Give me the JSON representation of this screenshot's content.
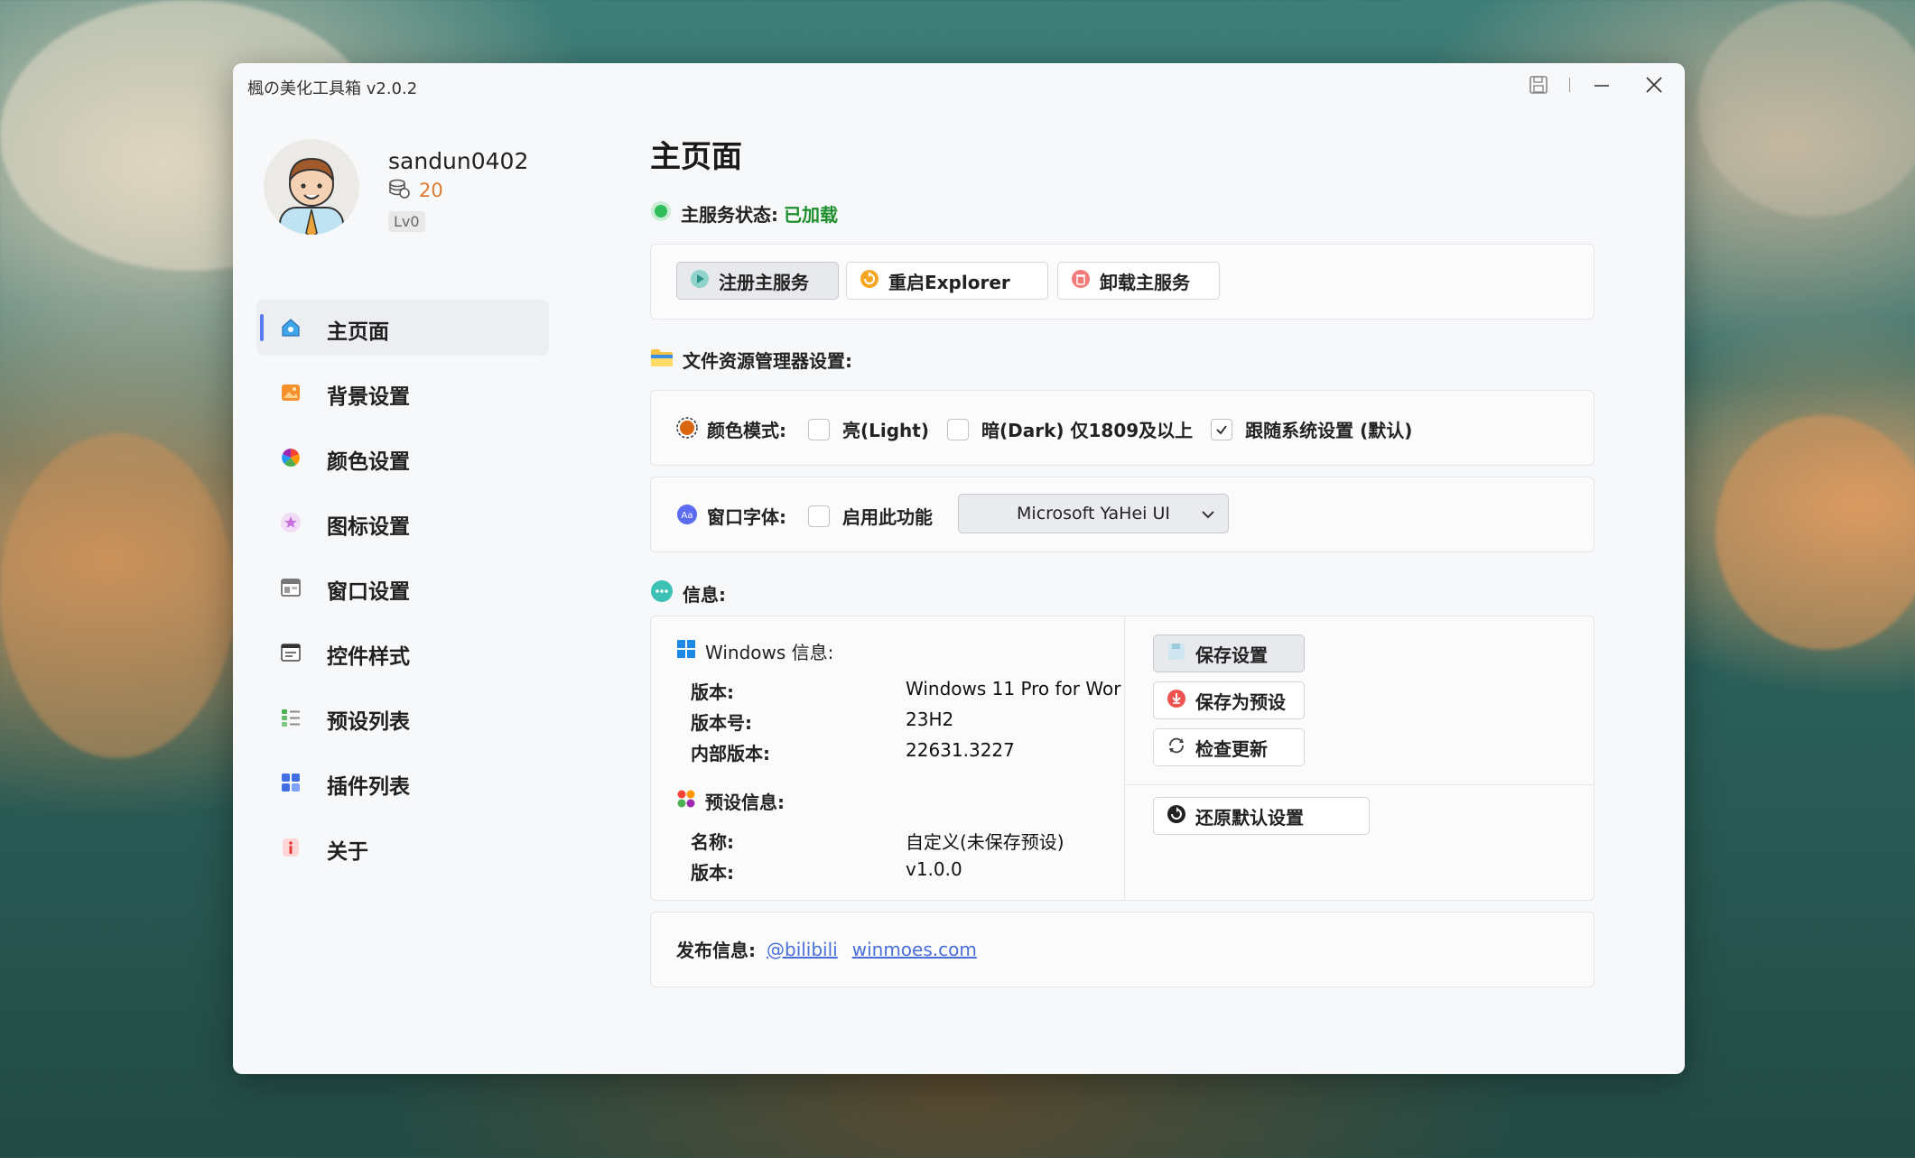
{
  "window": {
    "title": "楓の美化工具箱 v2.0.2"
  },
  "user": {
    "name": "sandun0402",
    "coins": "20",
    "level": "Lv0"
  },
  "nav": {
    "items": [
      {
        "label": "主页面",
        "icon": "home-icon"
      },
      {
        "label": "背景设置",
        "icon": "image-icon"
      },
      {
        "label": "颜色设置",
        "icon": "color-wheel-icon"
      },
      {
        "label": "图标设置",
        "icon": "star-icon"
      },
      {
        "label": "窗口设置",
        "icon": "window-icon"
      },
      {
        "label": "控件样式",
        "icon": "controls-icon"
      },
      {
        "label": "预设列表",
        "icon": "list-icon"
      },
      {
        "label": "插件列表",
        "icon": "plugins-icon"
      },
      {
        "label": "关于",
        "icon": "info-icon"
      }
    ]
  },
  "main": {
    "title": "主页面",
    "service_status_label": "主服务状态:",
    "service_status_value": "已加载",
    "service_buttons": {
      "register": "注册主服务",
      "restart": "重启Explorer",
      "uninstall": "卸载主服务"
    },
    "explorer_section": "文件资源管理器设置:",
    "color_mode": {
      "label": "颜色模式:",
      "light": "亮(Light)",
      "dark": "暗(Dark) 仅1809及以上",
      "follow": "跟随系统设置 (默认)"
    },
    "window_font": {
      "label": "窗口字体:",
      "enable": "启用此功能",
      "selected": "Microsoft YaHei UI"
    },
    "info_section": "信息:",
    "windows_info": {
      "title": "Windows 信息:",
      "version_label": "版本:",
      "version_value": "Windows 11 Pro for Wor",
      "build_label": "版本号:",
      "build_value": "23H2",
      "internal_label": "内部版本:",
      "internal_value": "22631.3227"
    },
    "preset_info": {
      "title": "预设信息:",
      "name_label": "名称:",
      "name_value": "自定义(未保存预设)",
      "version_label": "版本:",
      "version_value": "v1.0.0"
    },
    "actions": {
      "save": "保存设置",
      "save_preset": "保存为预设",
      "check_update": "检查更新",
      "restore": "还原默认设置"
    },
    "release": {
      "label": "发布信息:",
      "link1": "@bilibili",
      "link2": "winmoes.com"
    }
  }
}
